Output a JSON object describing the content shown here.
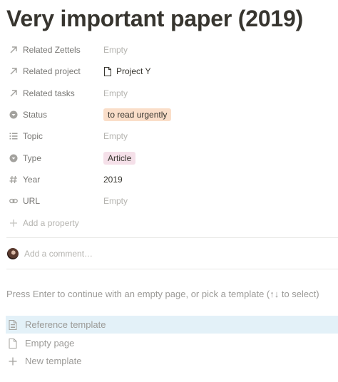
{
  "page": {
    "title": "Very important paper (2019)"
  },
  "properties": [
    {
      "name": "Related Zettels",
      "icon": "arrow-up-right-icon",
      "value": "Empty",
      "kind": "empty"
    },
    {
      "name": "Related project",
      "icon": "arrow-up-right-icon",
      "value": "Project Y",
      "kind": "page-link"
    },
    {
      "name": "Related tasks",
      "icon": "arrow-up-right-icon",
      "value": "Empty",
      "kind": "empty"
    },
    {
      "name": "Status",
      "icon": "select-icon",
      "value": "to read urgently",
      "kind": "tag",
      "tag_color": "#fadec9"
    },
    {
      "name": "Topic",
      "icon": "list-icon",
      "value": "Empty",
      "kind": "empty"
    },
    {
      "name": "Type",
      "icon": "select-icon",
      "value": "Article",
      "kind": "tag",
      "tag_color": "#f5e0e9"
    },
    {
      "name": "Year",
      "icon": "hash-icon",
      "value": "2019",
      "kind": "text"
    },
    {
      "name": "URL",
      "icon": "link-icon",
      "value": "Empty",
      "kind": "empty"
    }
  ],
  "add_property": {
    "label": "Add a property",
    "icon": "plus-icon"
  },
  "comment": {
    "placeholder": "Add a comment…",
    "icon": "avatar"
  },
  "template_hint": "Press Enter to continue with an empty page, or pick a template (↑↓ to select)",
  "templates": [
    {
      "label": "Reference template",
      "icon": "page-lines-icon",
      "highlighted": true
    },
    {
      "label": "Empty page",
      "icon": "page-icon",
      "highlighted": false
    },
    {
      "label": "New template",
      "icon": "plus-icon",
      "highlighted": false
    }
  ]
}
